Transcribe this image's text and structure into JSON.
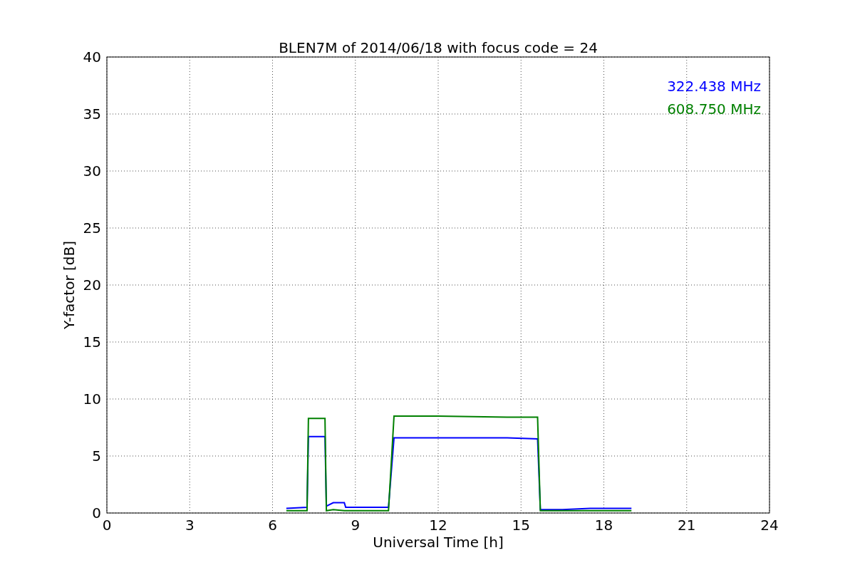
{
  "chart_data": {
    "type": "line",
    "title": "BLEN7M of 2014/06/18 with focus code = 24",
    "xlabel": "Universal Time [h]",
    "ylabel": "Y-factor [dB]",
    "x": [
      6.5,
      7.25,
      7.3,
      7.9,
      7.95,
      8.2,
      8.6,
      8.65,
      10.2,
      10.4,
      12,
      14.5,
      15.6,
      15.7,
      16.5,
      17.5,
      19
    ],
    "series": [
      {
        "name": "322.438 MHz",
        "color": "#0000ff",
        "values": [
          0.4,
          0.5,
          6.7,
          6.7,
          0.6,
          0.9,
          0.9,
          0.5,
          0.5,
          6.6,
          6.6,
          6.6,
          6.5,
          0.3,
          0.3,
          0.4,
          0.4
        ]
      },
      {
        "name": "608.750 MHz",
        "color": "#008000",
        "values": [
          0.2,
          0.2,
          8.3,
          8.3,
          0.2,
          0.3,
          0.2,
          0.2,
          0.2,
          8.5,
          8.5,
          8.4,
          8.4,
          0.2,
          0.2,
          0.2,
          0.2
        ]
      }
    ],
    "xlim": [
      0,
      24
    ],
    "ylim": [
      0,
      40
    ],
    "xticks": [
      0,
      3,
      6,
      9,
      12,
      15,
      18,
      21,
      24
    ],
    "yticks": [
      0,
      5,
      10,
      15,
      20,
      25,
      30,
      35,
      40
    ],
    "grid": true
  }
}
